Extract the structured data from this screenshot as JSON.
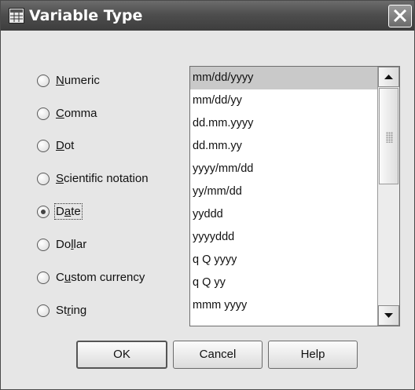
{
  "window": {
    "title": "Variable Type"
  },
  "radio_options": [
    {
      "pre": "",
      "mnemonic": "N",
      "post": "umeric",
      "selected": false
    },
    {
      "pre": "",
      "mnemonic": "C",
      "post": "omma",
      "selected": false
    },
    {
      "pre": "",
      "mnemonic": "D",
      "post": "ot",
      "selected": false
    },
    {
      "pre": "",
      "mnemonic": "S",
      "post": "cientific notation",
      "selected": false
    },
    {
      "pre": "D",
      "mnemonic": "a",
      "post": "te",
      "selected": true
    },
    {
      "pre": "Do",
      "mnemonic": "l",
      "post": "lar",
      "selected": false
    },
    {
      "pre": "C",
      "mnemonic": "u",
      "post": "stom currency",
      "selected": false
    },
    {
      "pre": "St",
      "mnemonic": "r",
      "post": "ing",
      "selected": false
    }
  ],
  "date_formats": {
    "selected_index": 0,
    "items": [
      "mm/dd/yyyy",
      "mm/dd/yy",
      "dd.mm.yyyy",
      "dd.mm.yy",
      "yyyy/mm/dd",
      "yy/mm/dd",
      "yyddd",
      "yyyyddd",
      "q Q yyyy",
      "q Q yy",
      "mmm yyyy"
    ]
  },
  "buttons": {
    "ok": "OK",
    "cancel": "Cancel",
    "help": "Help"
  }
}
